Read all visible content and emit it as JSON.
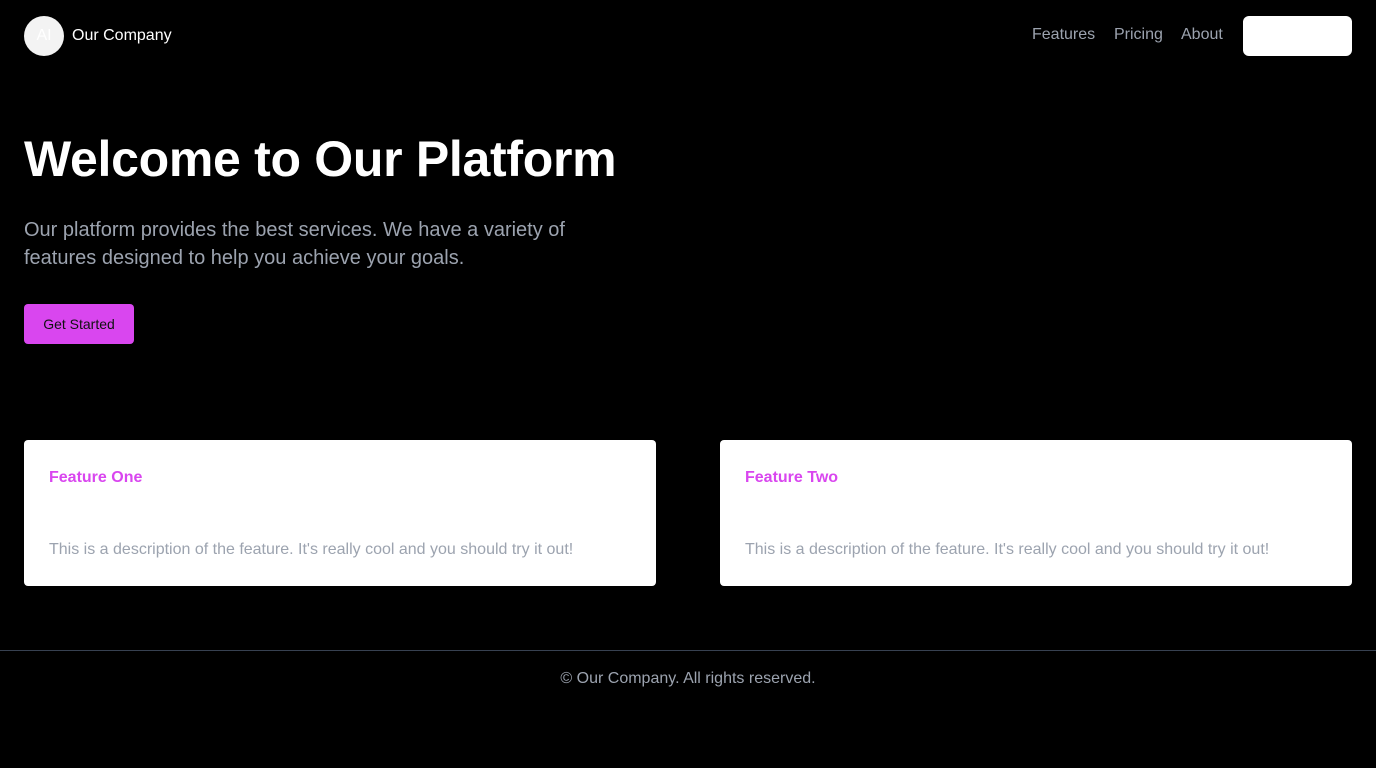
{
  "header": {
    "logo_text": "AI",
    "brand": "Our Company",
    "nav": [
      "Features",
      "Pricing",
      "About"
    ],
    "button_label": ""
  },
  "hero": {
    "title": "Welcome to Our Platform",
    "subtitle": "Our platform provides the best services. We have a variety of features designed to help you achieve your goals.",
    "cta_label": "Get Started"
  },
  "features": [
    {
      "title": "Feature One",
      "description": "This is a description of the feature. It's really cool and you should try it out!"
    },
    {
      "title": "Feature Two",
      "description": "This is a description of the feature. It's really cool and you should try it out!"
    }
  ],
  "footer": {
    "text": "© Our Company. All rights reserved."
  },
  "colors": {
    "background": "#000000",
    "accent": "#d946ef",
    "muted_text": "#9ca3af",
    "card_background": "#ffffff",
    "divider": "#374151"
  }
}
